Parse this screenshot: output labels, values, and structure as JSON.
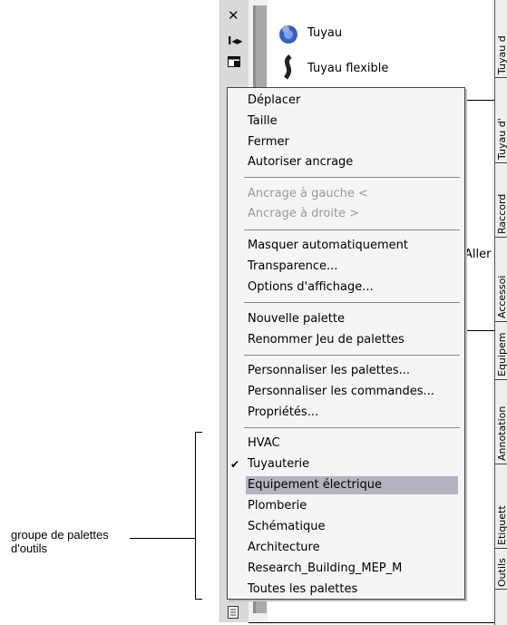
{
  "palette": {
    "tools": [
      {
        "label": "Tuyau",
        "icon": "pipe-icon"
      },
      {
        "label": "Tuyau flexible",
        "icon": "flexible-pipe-icon"
      }
    ],
    "hidden_text": "Aller",
    "tabs": [
      "Tuyau d",
      "Tuyau d'",
      "Raccord",
      "Accessoi",
      "Equipem",
      "Annotation",
      "Etiquett",
      "Outils"
    ]
  },
  "menu": {
    "group1": [
      "Déplacer",
      "Taille",
      "Fermer",
      "Autoriser ancrage"
    ],
    "group2": [
      "Ancrage à gauche  <",
      "Ancrage à droite  >"
    ],
    "group3": [
      "Masquer automatiquement",
      "Transparence...",
      "Options d'affichage..."
    ],
    "group4": [
      "Nouvelle palette",
      "Renommer Jeu de palettes"
    ],
    "group5": [
      "Personnaliser les palettes...",
      "Personnaliser les commandes...",
      "Propriétés..."
    ],
    "groups_list": [
      "HVAC",
      "Tuyauterie",
      "Equipement électrique",
      "Plomberie",
      "Schématique",
      "Architecture",
      "Research_Building_MEP_M",
      "Toutes les palettes"
    ],
    "checked_item": "Tuyauterie",
    "highlighted_item": "Equipement électrique",
    "check_mark": "✔"
  },
  "callout": {
    "label": "groupe de palettes\nd'outils"
  },
  "colors": {
    "highlight": "#b5b3c2",
    "disabled_text": "#9a9a9a"
  }
}
